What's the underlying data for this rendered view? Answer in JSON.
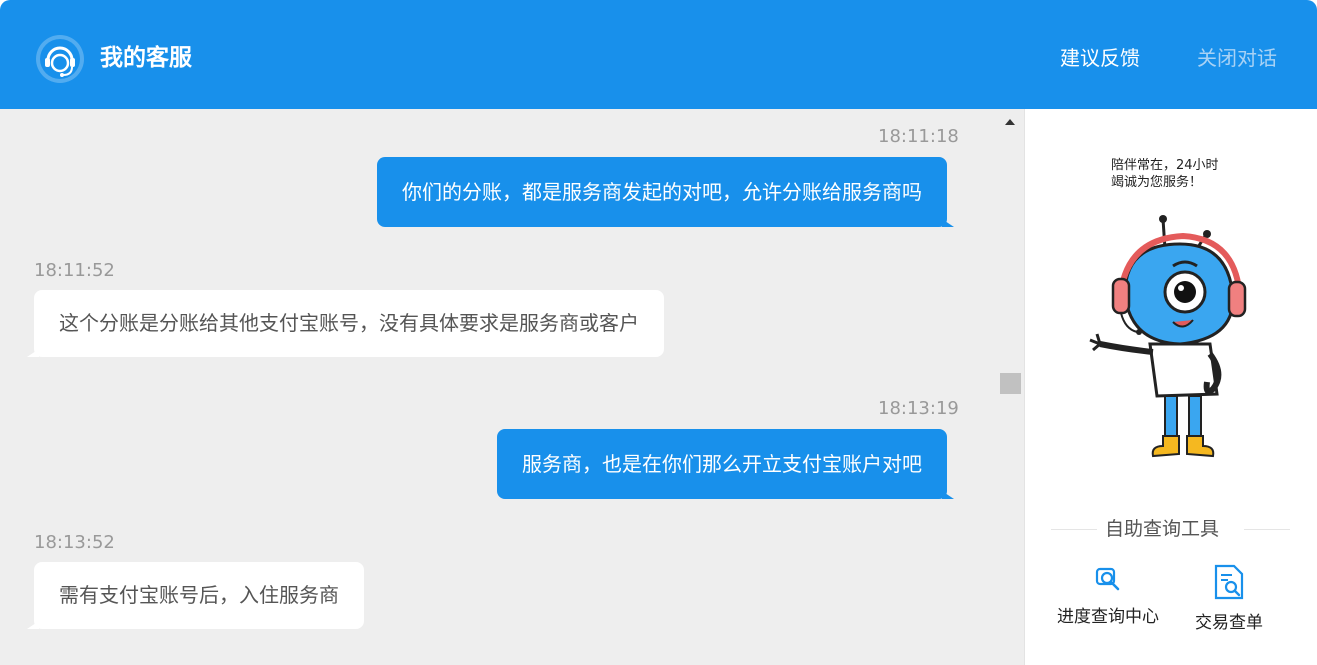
{
  "header": {
    "title": "我的客服",
    "feedback_label": "建议反馈",
    "close_label": "关闭对话"
  },
  "messages": [
    {
      "from": "me",
      "time": "18:11:18",
      "text": "你们的分账，都是服务商发起的对吧，允许分账给服务商吗"
    },
    {
      "from": "agent",
      "time": "18:11:52",
      "text": "这个分账是分账给其他支付宝账号，没有具体要求是服务商或客户"
    },
    {
      "from": "me",
      "time": "18:13:19",
      "text": "服务商，也是在你们那么开立支付宝账户对吧"
    },
    {
      "from": "agent",
      "time": "18:13:52",
      "text": "需有支付宝账号后，入住服务商"
    }
  ],
  "sidebar": {
    "slogan": "陪伴常在，24小时\n竭诚为您服务！",
    "tools_title": "自助查询工具",
    "tools": [
      {
        "label": "进度查询中心",
        "icon": "search-progress-icon"
      },
      {
        "label": "交易查单",
        "icon": "document-search-icon"
      }
    ]
  },
  "colors": {
    "brand": "#1890eb",
    "chat_bg": "#eeeeee",
    "agent_bubble": "#ffffff"
  }
}
